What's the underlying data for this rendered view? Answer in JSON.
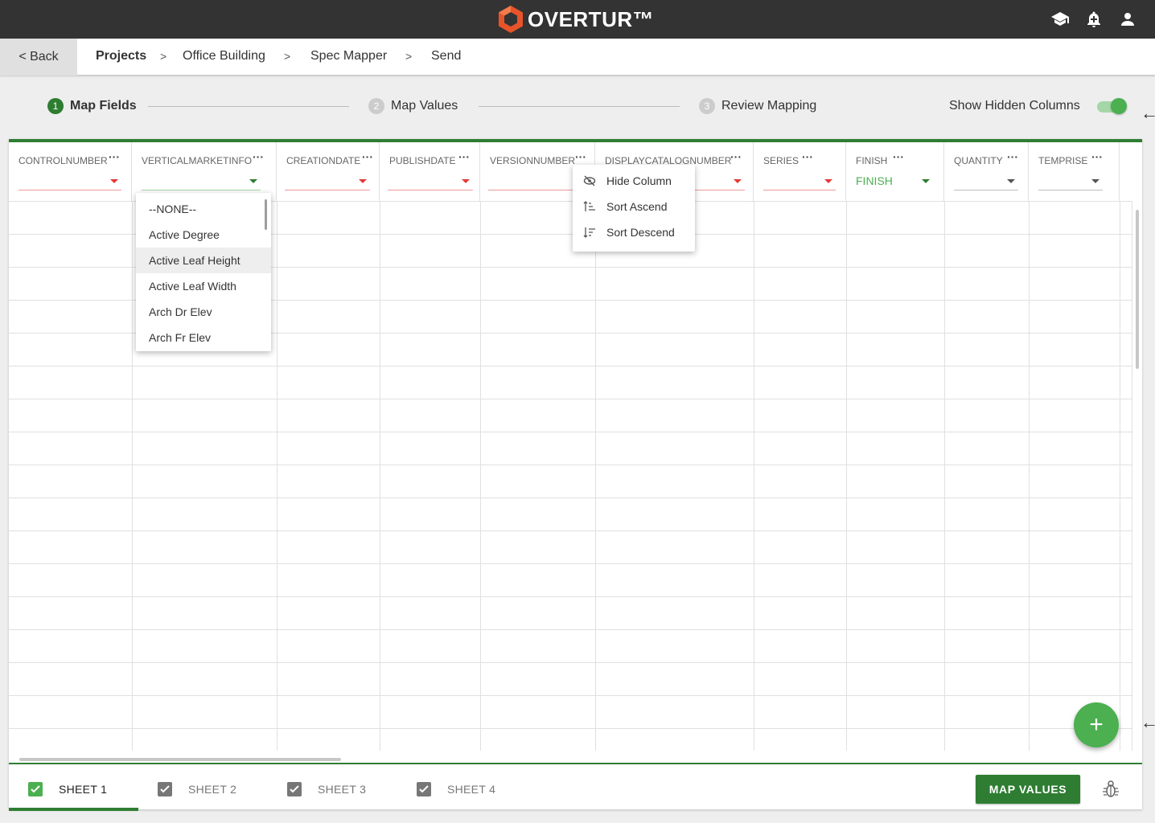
{
  "app": {
    "logo_text": "OVERTUR™"
  },
  "header_icons": [
    "graduation-cap-icon",
    "notification-add-icon",
    "account-icon"
  ],
  "breadcrumb": {
    "back_label": "< Back",
    "items": [
      "Projects",
      "Office Building",
      "Spec Mapper",
      "Send"
    ],
    "separator": ">"
  },
  "stepper": {
    "steps": [
      {
        "num": "1",
        "label": "Map Fields",
        "active": true
      },
      {
        "num": "2",
        "label": "Map Values",
        "active": false
      },
      {
        "num": "3",
        "label": "Review Mapping",
        "active": false
      }
    ]
  },
  "hidden_columns": {
    "label": "Show Hidden Columns",
    "enabled": true
  },
  "side_arrow": "←",
  "columns": [
    {
      "name": "CONTROLNUMBER",
      "value": ""
    },
    {
      "name": "VERTICALMARKETINFO",
      "value": ""
    },
    {
      "name": "CREATIONDATE",
      "value": ""
    },
    {
      "name": "PUBLISHDATE",
      "value": ""
    },
    {
      "name": "VERSIONNUMBER",
      "value": ""
    },
    {
      "name": "DISPLAYCATALOGNUMBER",
      "value": ""
    },
    {
      "name": "SERIES",
      "value": ""
    },
    {
      "name": "FINISH",
      "value": "FINISH"
    },
    {
      "name": "QUANTITY",
      "value": ""
    },
    {
      "name": "TEMPRISE",
      "value": ""
    }
  ],
  "column_menu_glyph": "···",
  "dropdown": {
    "options": [
      "--NONE--",
      "Active Degree",
      "Active Leaf Height",
      "Active Leaf Width",
      "Arch Dr Elev",
      "Arch Fr Elev"
    ],
    "highlighted": "Active Leaf Height"
  },
  "context_menu": {
    "items": [
      {
        "label": "Hide Column",
        "icon": "eye-off-icon"
      },
      {
        "label": "Sort Ascend",
        "icon": "sort-ascending-icon"
      },
      {
        "label": "Sort Descend",
        "icon": "sort-descending-icon"
      }
    ]
  },
  "fab_label": "+",
  "sheets": [
    {
      "label": "SHEET 1",
      "active": true
    },
    {
      "label": "SHEET 2",
      "active": false
    },
    {
      "label": "SHEET 3",
      "active": false
    },
    {
      "label": "SHEET 4",
      "active": false
    }
  ],
  "actions": {
    "map_values_label": "MAP VALUES"
  },
  "colors": {
    "accent": "#2e7d32",
    "accent_light": "#4caf50",
    "error": "#e53935",
    "topbar": "#333333",
    "logo_orange": "#e8542a"
  }
}
